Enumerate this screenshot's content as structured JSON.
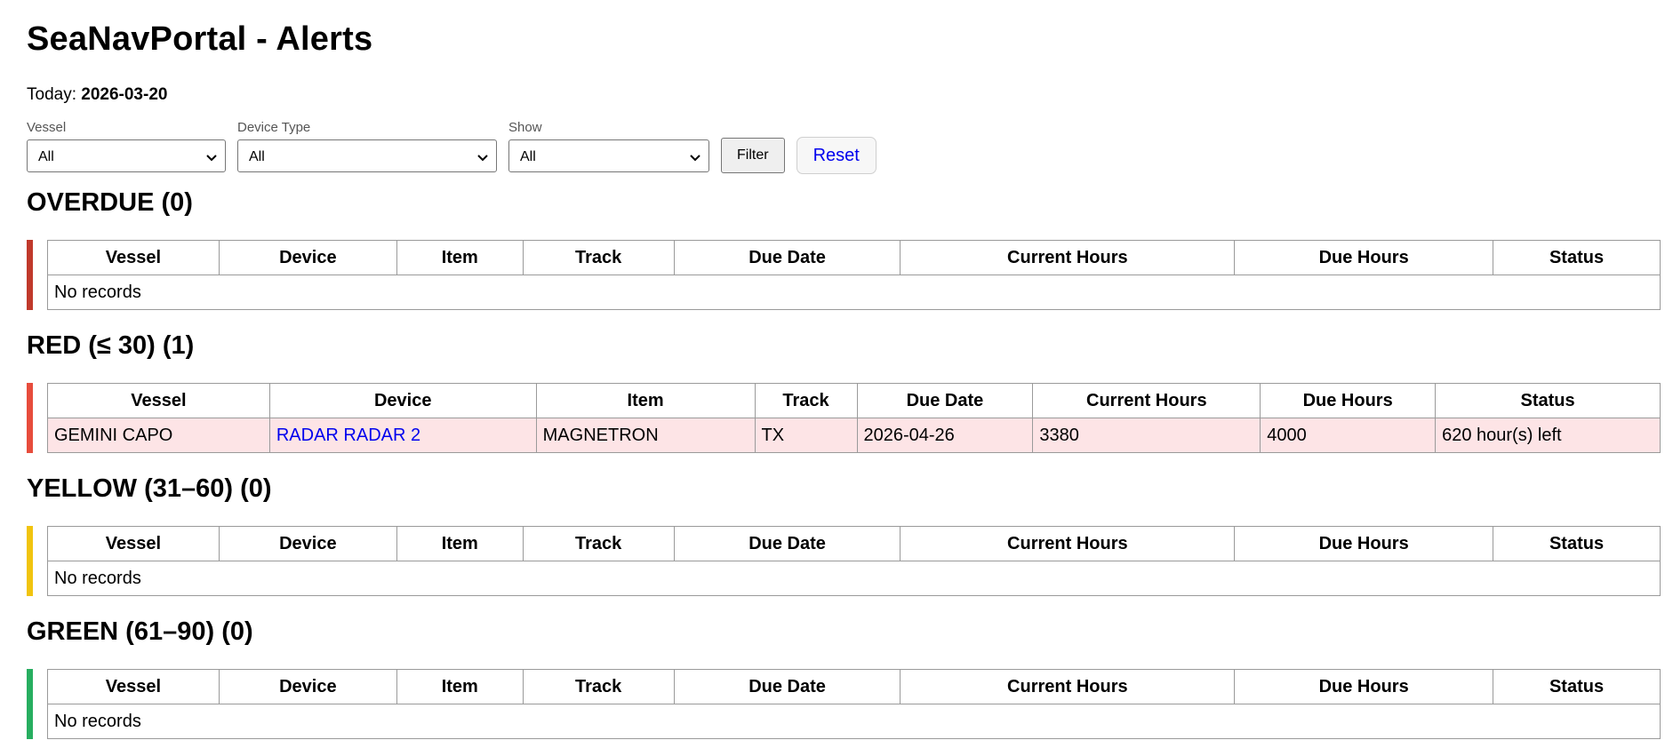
{
  "page": {
    "title": "SeaNavPortal - Alerts",
    "today_label": "Today:",
    "today_value": "2026-03-20"
  },
  "filters": {
    "vessel": {
      "label": "Vessel",
      "value": "All"
    },
    "device_type": {
      "label": "Device Type",
      "value": "All"
    },
    "show": {
      "label": "Show",
      "value": "All"
    },
    "filter_button": "Filter",
    "reset_button": "Reset"
  },
  "columns": [
    "Vessel",
    "Device",
    "Item",
    "Track",
    "Due Date",
    "Current Hours",
    "Due Hours",
    "Status"
  ],
  "sections": {
    "overdue": {
      "heading": "OVERDUE (0)",
      "color": "#c0392b",
      "empty_text": "No records"
    },
    "red": {
      "heading": "RED (≤ 30) (1)",
      "color": "#e74c3c",
      "row_bg": "#fde4e6",
      "rows": [
        {
          "vessel": "GEMINI CAPO",
          "device": "RADAR RADAR 2",
          "item": "MAGNETRON",
          "track": "TX",
          "due_date": "2026-04-26",
          "current_hours": "3380",
          "due_hours": "4000",
          "status": "620 hour(s) left"
        }
      ]
    },
    "yellow": {
      "heading": "YELLOW (31–60) (0)",
      "color": "#f1c40f",
      "empty_text": "No records"
    },
    "green": {
      "heading": "GREEN (61–90) (0)",
      "color": "#27ae60",
      "empty_text": "No records"
    }
  }
}
